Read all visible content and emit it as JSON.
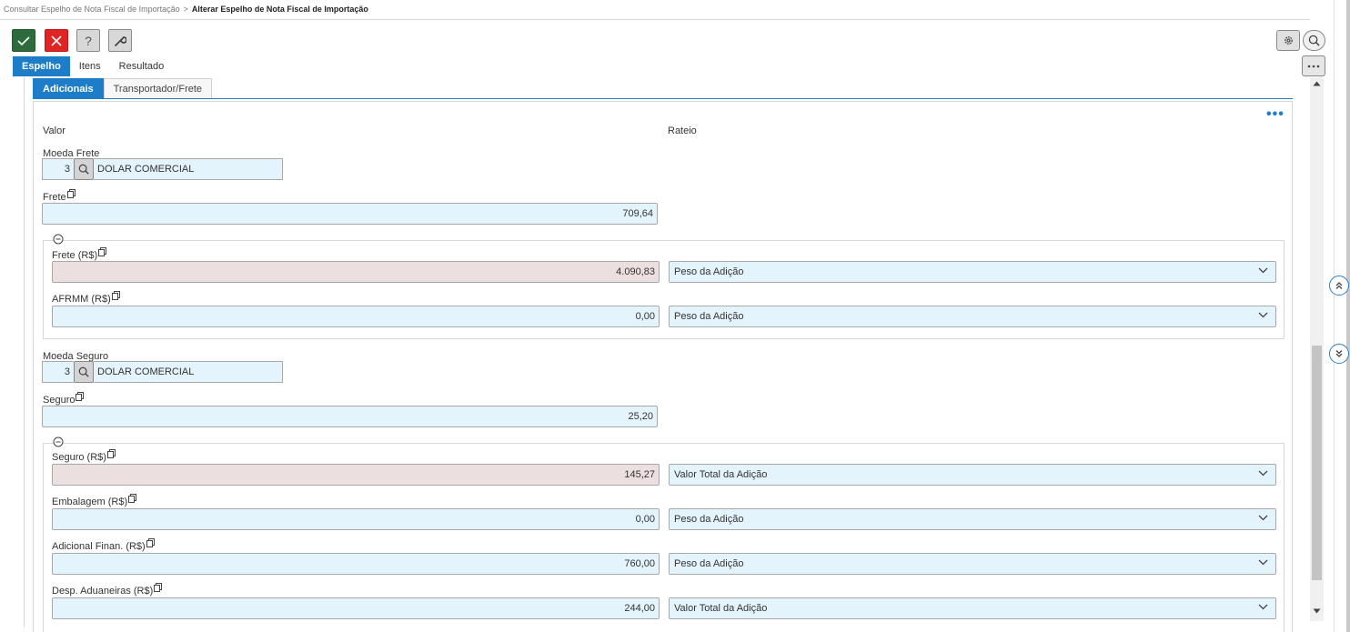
{
  "breadcrumb": {
    "parent": "Consultar Espelho de Nota Fiscal de Importação",
    "separator": ">",
    "current": "Alterar Espelho de Nota Fiscal de Importação"
  },
  "toolbar": {
    "confirm_icon": "check-icon",
    "cancel_icon": "close-icon",
    "help_label": "?",
    "tool_icon": "wrench-icon"
  },
  "main_tabs": [
    {
      "label": "Espelho",
      "active": true
    },
    {
      "label": "Itens",
      "active": false
    },
    {
      "label": "Resultado",
      "active": false
    }
  ],
  "sub_tabs": [
    {
      "label": "Adicionais",
      "active": true
    },
    {
      "label": "Transportador/Frete",
      "active": false
    }
  ],
  "form": {
    "col_valor": "Valor",
    "col_rateio": "Rateio",
    "moeda_frete": {
      "label": "Moeda Frete",
      "code": "3",
      "description": "DOLAR COMERCIAL"
    },
    "frete": {
      "label": "Frete",
      "value": "709,64"
    },
    "frete_rs": {
      "label": "Frete (R$)",
      "value": "4.090,83",
      "rateio": "Peso da Adição"
    },
    "afrmm_rs": {
      "label": "AFRMM (R$)",
      "value": "0,00",
      "rateio": "Peso da Adição"
    },
    "moeda_seguro": {
      "label": "Moeda Seguro",
      "code": "3",
      "description": "DOLAR COMERCIAL"
    },
    "seguro": {
      "label": "Seguro",
      "value": "25,20"
    },
    "seguro_rs": {
      "label": "Seguro (R$)",
      "value": "145,27",
      "rateio": "Valor Total da Adição"
    },
    "embalagem_rs": {
      "label": "Embalagem (R$)",
      "value": "0,00",
      "rateio": "Peso da Adição"
    },
    "adicional_finan_rs": {
      "label": "Adicional Finan. (R$)",
      "value": "760,00",
      "rateio": "Peso da Adição"
    },
    "desp_aduaneiras_rs": {
      "label": "Desp. Aduaneiras (R$)",
      "value": "244,00",
      "rateio": "Valor Total da Adição"
    }
  },
  "colors": {
    "accent": "#1d7dc8",
    "confirm": "#2e6b3c",
    "cancel": "#e02424",
    "field_bg": "#e4f4fd",
    "readonly_bg": "#ecdfdf"
  }
}
